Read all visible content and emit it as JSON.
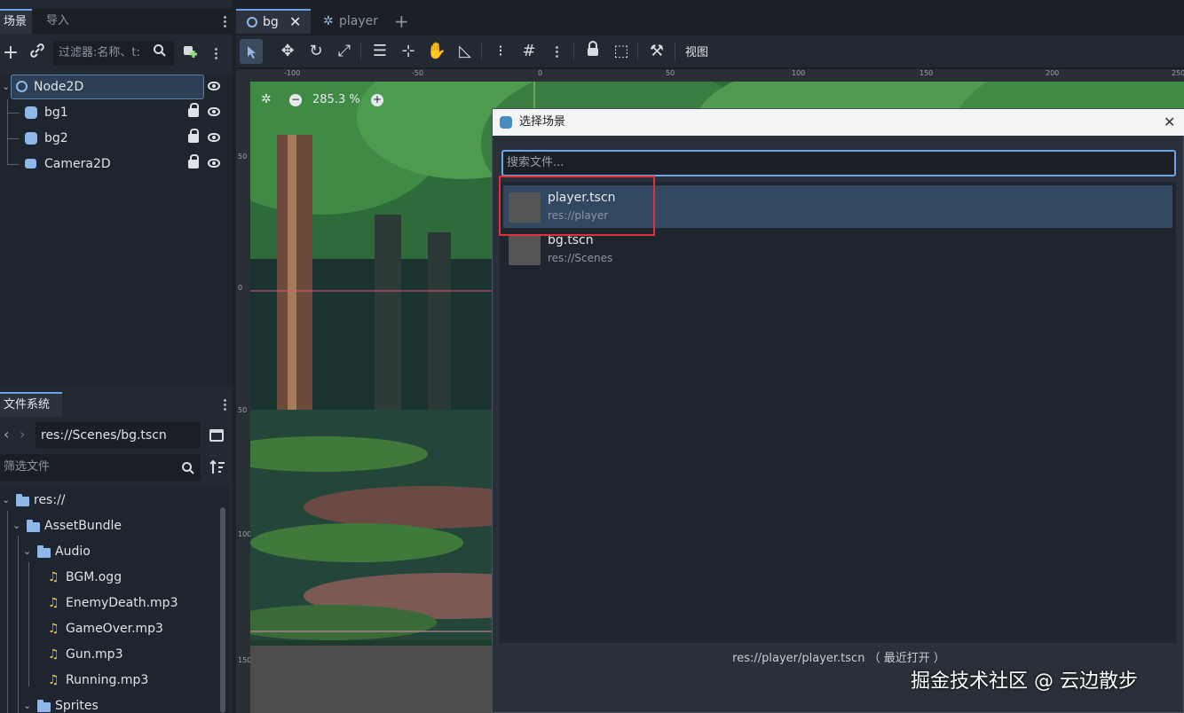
{
  "left_dock": {
    "tabs": [
      "场景",
      "导入"
    ],
    "filter_placeholder": "过滤器:名称、t:",
    "tree": [
      {
        "label": "Node2D",
        "type": "node2d"
      },
      {
        "label": "bg1",
        "type": "sprite"
      },
      {
        "label": "bg2",
        "type": "sprite"
      },
      {
        "label": "Camera2D",
        "type": "camera"
      }
    ]
  },
  "filesystem": {
    "tab": "文件系统",
    "path": "res://Scenes/bg.tscn",
    "filter_placeholder": "筛选文件",
    "items": [
      {
        "label": "res://",
        "kind": "folder",
        "depth": 0
      },
      {
        "label": "AssetBundle",
        "kind": "folder",
        "depth": 1
      },
      {
        "label": "Audio",
        "kind": "folder",
        "depth": 2
      },
      {
        "label": "BGM.ogg",
        "kind": "audio",
        "depth": 3
      },
      {
        "label": "EnemyDeath.mp3",
        "kind": "audio",
        "depth": 3
      },
      {
        "label": "GameOver.mp3",
        "kind": "audio",
        "depth": 3
      },
      {
        "label": "Gun.mp3",
        "kind": "audio",
        "depth": 3
      },
      {
        "label": "Running.mp3",
        "kind": "audio",
        "depth": 3
      },
      {
        "label": "Sprites",
        "kind": "folder",
        "depth": 2
      }
    ]
  },
  "editor": {
    "tabs": [
      {
        "label": "bg",
        "active": true
      },
      {
        "label": "player",
        "active": false
      }
    ],
    "view_menu": "视图",
    "zoom": "285.3 %",
    "ruler_top": [
      "-100",
      "-50",
      "0",
      "50",
      "100",
      "150",
      "200",
      "250"
    ],
    "ruler_left": [
      "50",
      "0",
      "50",
      "100",
      "150"
    ]
  },
  "dialog": {
    "title": "选择场景",
    "search_placeholder": "搜索文件...",
    "items": [
      {
        "name": "player.tscn",
        "path": "res://player",
        "selected": true
      },
      {
        "name": "bg.tscn",
        "path": "res://Scenes",
        "selected": false
      }
    ],
    "status": "res://player/player.tscn （ 最近打开 ）"
  },
  "watermark": "掘金技术社区 @ 云边散步",
  "colors": {
    "accent": "#6ba5e8",
    "highlight": "#e0303a",
    "selection": "#324760"
  }
}
